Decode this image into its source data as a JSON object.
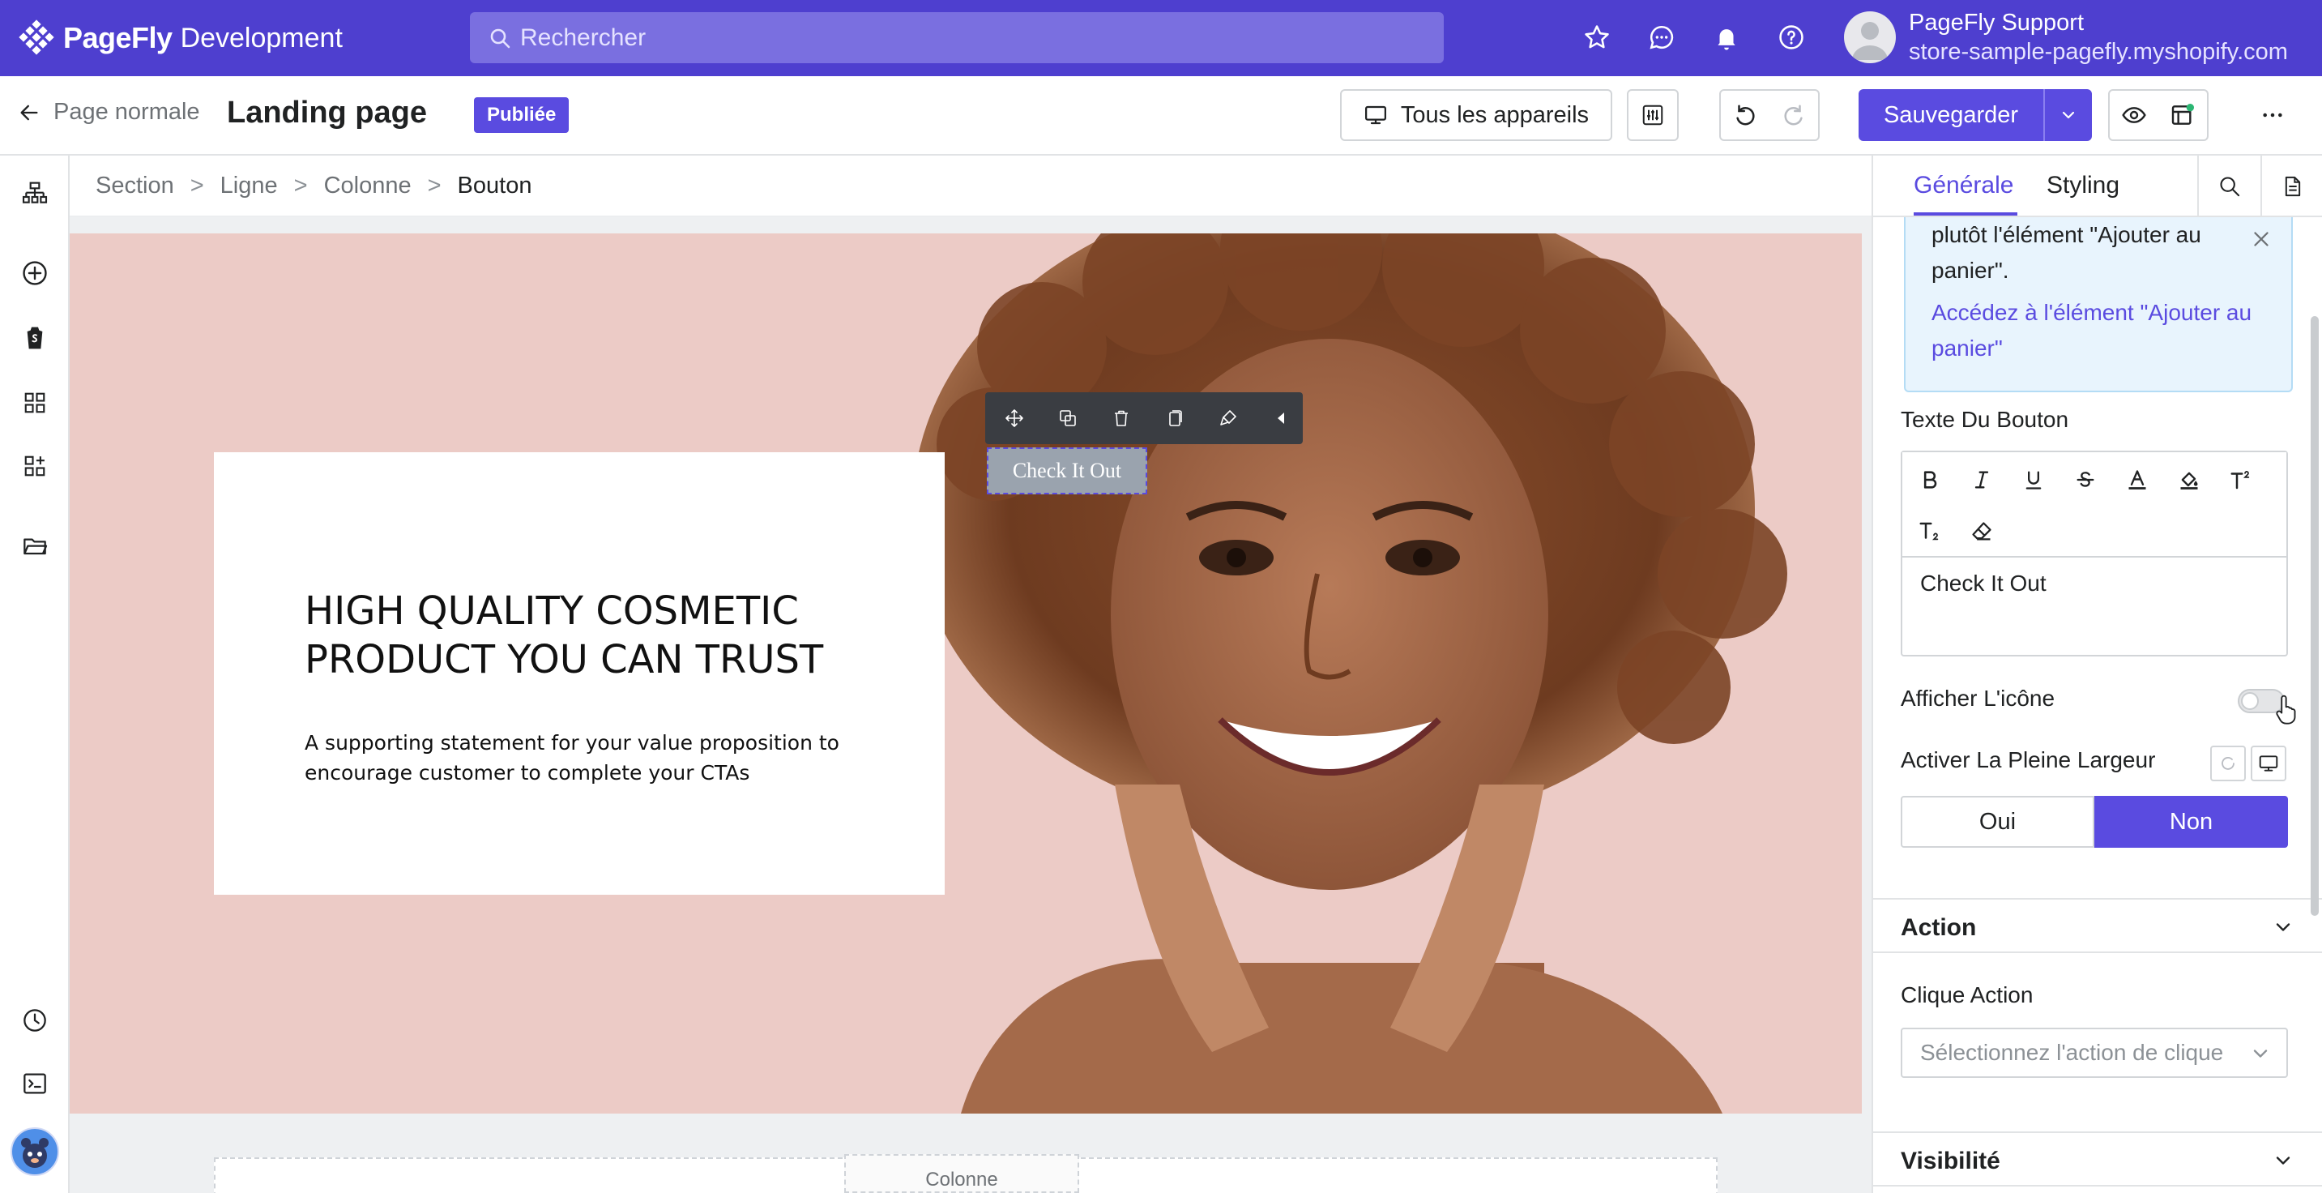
{
  "app": {
    "brand": "PageFly",
    "environment": "Development",
    "search_placeholder": "Rechercher",
    "account_name": "PageFly Support",
    "account_store": "store-sample-pagefly.myshopify.com"
  },
  "toolbar": {
    "back_label": "Page normale",
    "page_title": "Landing page",
    "status_badge": "Publiée",
    "devices_label": "Tous les appareils",
    "save_label": "Sauvegarder"
  },
  "breadcrumb": [
    "Section",
    "Ligne",
    "Colonne",
    "Bouton"
  ],
  "canvas": {
    "hero_title": "HIGH QUALITY COSMETIC PRODUCT YOU CAN TRUST",
    "hero_subtitle": " A supporting statement for your value proposition to encourage customer to complete your CTAs",
    "cta_label": "Check It Out",
    "column_tag": "Colonne"
  },
  "panel": {
    "tab_general": "Générale",
    "tab_styling": "Styling",
    "note_text": "plutôt l'élément \"Ajouter au panier\".",
    "note_link": "Accédez à l'élément \"Ajouter au panier\"",
    "button_text_label": "Texte Du Bouton",
    "button_text_value": "Check It Out",
    "show_icon_label": "Afficher L'icône",
    "show_icon_on": false,
    "full_width_label": "Activer La Pleine Largeur",
    "full_width_yes": "Oui",
    "full_width_no": "Non",
    "full_width_selected": "Non",
    "action_section": "Action",
    "click_action_label": "Clique Action",
    "click_action_placeholder": "Sélectionnez l'action de clique",
    "visibility_section": "Visibilité"
  },
  "colors": {
    "brand": "#4e3fcf",
    "accent": "#5a4be0",
    "hero_bg": "#eccbc6",
    "note_bg": "#e8f4fd"
  }
}
